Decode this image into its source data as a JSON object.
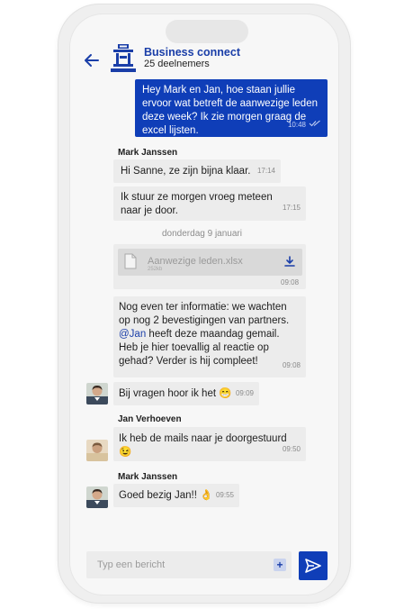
{
  "header": {
    "group_name": "Business connect",
    "participants": "25 deelnemers"
  },
  "messages": {
    "m1": {
      "text": "Hey Mark en Jan, hoe staan jullie ervoor wat betreft de aanwezige leden deze week? Ik zie morgen graag de excel lijsten.",
      "time": "10:48"
    },
    "m2": {
      "sender": "Mark Janssen",
      "text": "Hi Sanne, ze zijn bijna klaar.",
      "time": "17:14"
    },
    "m3": {
      "text": "Ik stuur ze morgen vroeg meteen naar je door.",
      "time": "17:15"
    },
    "date_separator": "donderdag 9 januari",
    "file": {
      "name": "Aanwezige leden.xlsx",
      "size": "252kb",
      "time": "09:08"
    },
    "m5": {
      "text_before": "Nog even ter informatie: we wachten op nog 2 bevestigingen van partners.",
      "mention": "@Jan",
      "text_after": "heeft deze maandag gemail. Heb je hier toevallig al reactie op gehad? Verder is hij compleet!",
      "time": "09:08"
    },
    "m6": {
      "text": "Bij vragen hoor ik het 😁",
      "time": "09:09"
    },
    "m7": {
      "sender": "Jan Verhoeven",
      "text": "Ik heb de mails naar je doorgestuurd 😉",
      "time": "09:50"
    },
    "m8": {
      "sender": "Mark Janssen",
      "text": "Goed bezig Jan!! 👌",
      "time": "09:55"
    }
  },
  "composer": {
    "placeholder": "Typ een bericht",
    "plus_label": "+"
  },
  "colors": {
    "brand": "#0f3eb8",
    "bubble_in": "#ececec"
  }
}
